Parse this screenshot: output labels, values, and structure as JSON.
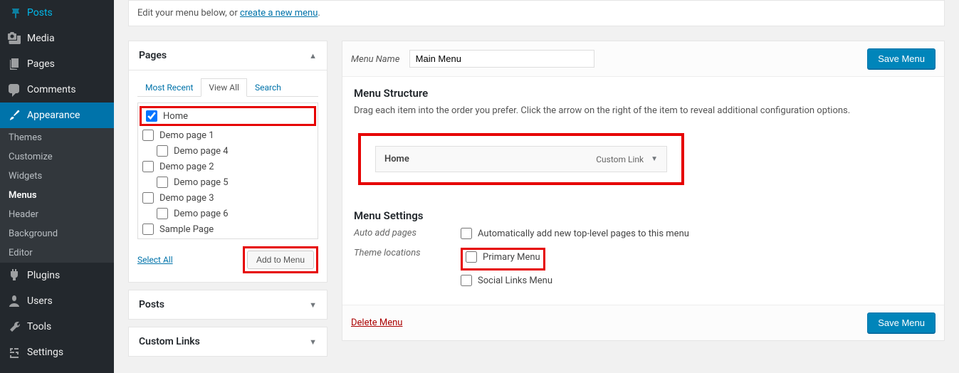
{
  "sidebar": {
    "items": [
      {
        "label": "Posts",
        "icon": "pin"
      },
      {
        "label": "Media",
        "icon": "media"
      },
      {
        "label": "Pages",
        "icon": "page"
      },
      {
        "label": "Comments",
        "icon": "comment"
      },
      {
        "label": "Appearance",
        "icon": "brush",
        "active": true
      },
      {
        "label": "Plugins",
        "icon": "plugin"
      },
      {
        "label": "Users",
        "icon": "user"
      },
      {
        "label": "Tools",
        "icon": "wrench"
      },
      {
        "label": "Settings",
        "icon": "settings"
      }
    ],
    "subitems": [
      "Themes",
      "Customize",
      "Widgets",
      "Menus",
      "Header",
      "Background",
      "Editor"
    ],
    "active_sub": "Menus"
  },
  "notice": {
    "prefix": "Edit your menu below, or ",
    "link": "create a new menu",
    "suffix": "."
  },
  "left": {
    "pages_title": "Pages",
    "tabs": [
      "Most Recent",
      "View All",
      "Search"
    ],
    "active_tab": "View All",
    "pages": [
      {
        "label": "Home",
        "checked": true,
        "indent": false,
        "highlight": true
      },
      {
        "label": "Demo page 1",
        "checked": false,
        "indent": false
      },
      {
        "label": "Demo page 4",
        "checked": false,
        "indent": true
      },
      {
        "label": "Demo page 2",
        "checked": false,
        "indent": false
      },
      {
        "label": "Demo page 5",
        "checked": false,
        "indent": true
      },
      {
        "label": "Demo page 3",
        "checked": false,
        "indent": false
      },
      {
        "label": "Demo page 6",
        "checked": false,
        "indent": true
      },
      {
        "label": "Sample Page",
        "checked": false,
        "indent": false
      }
    ],
    "select_all": "Select All",
    "add_to_menu": "Add to Menu",
    "posts_title": "Posts",
    "custom_links_title": "Custom Links"
  },
  "right": {
    "menu_name_label": "Menu Name",
    "menu_name_value": "Main Menu",
    "save_button": "Save Menu",
    "structure_title": "Menu Structure",
    "structure_desc": "Drag each item into the order you prefer. Click the arrow on the right of the item to reveal additional configuration options.",
    "menu_item": {
      "title": "Home",
      "type": "Custom Link"
    },
    "settings_title": "Menu Settings",
    "auto_add_label": "Auto add pages",
    "auto_add_option": "Automatically add new top-level pages to this menu",
    "theme_loc_label": "Theme locations",
    "theme_loc_options": [
      "Primary Menu",
      "Social Links Menu"
    ],
    "delete_menu": "Delete Menu"
  }
}
